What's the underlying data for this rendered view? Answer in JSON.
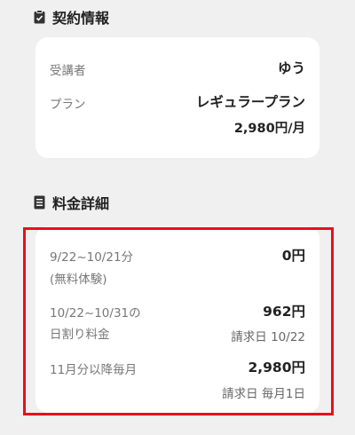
{
  "contract": {
    "title": "契約情報",
    "icon": "clipboard-icon",
    "student_label": "受講者",
    "student_value": "ゆう",
    "plan_label": "プラン",
    "plan_value": "レギュラープラン",
    "plan_price": "2,980円/月"
  },
  "fees": {
    "title": "料金詳細",
    "icon": "receipt-icon",
    "trial": {
      "label_line1": "9/22~10/21分",
      "label_line2": "(無料体験)",
      "amount": "0円"
    },
    "prorated": {
      "label_line1": "10/22~10/31の",
      "label_line2": "日割り料金",
      "amount": "962円",
      "billing": "請求日 10/22"
    },
    "monthly": {
      "label": "11月分以降毎月",
      "amount": "2,980円",
      "billing": "請求日 毎月1日"
    }
  },
  "colors": {
    "background": "#f0f0f0",
    "card": "#ffffff",
    "highlight": "#e8101a"
  }
}
